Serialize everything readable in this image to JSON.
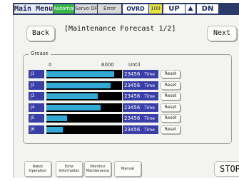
{
  "status_bar": {
    "main_menu": "Main Menu",
    "mode": "Automatic",
    "servo": "Servo OFF",
    "error": "Error",
    "ovrd": "OVRD",
    "override_pct": "100",
    "up_label": "UP",
    "arrow_up": "▲",
    "dn_label": "DN",
    "colors": {
      "bar_bg": "#2b3a6a",
      "mode_green": "#39b54a",
      "ovrd_yellow": "#e8e23a"
    }
  },
  "header": {
    "back_label": "Back",
    "title": "[Maintenance Forecast 1/2]",
    "next_label": "Next"
  },
  "grease": {
    "group_title": "Grease",
    "scale_min": "0",
    "scale_max": "6000",
    "scale_unit": "Until",
    "rows": [
      {
        "axis": "J1",
        "fill": 0.9,
        "remaining": "23456",
        "unit": "Time",
        "reset_label": "Reset"
      },
      {
        "axis": "J2",
        "fill": 0.85,
        "remaining": "23456",
        "unit": "Time",
        "reset_label": "Reset"
      },
      {
        "axis": "J3",
        "fill": 0.68,
        "remaining": "23456",
        "unit": "Time",
        "reset_label": "Reset"
      },
      {
        "axis": "J4",
        "fill": 0.72,
        "remaining": "23456",
        "unit": "Time",
        "reset_label": "Reset"
      },
      {
        "axis": "J5",
        "fill": 0.27,
        "remaining": "23456",
        "unit": "Time",
        "reset_label": "Reset"
      },
      {
        "axis": "J6",
        "fill": 0.22,
        "remaining": "23456",
        "unit": "Time",
        "reset_label": "Reset"
      }
    ],
    "colors": {
      "axis_bg": "#3a3fa8",
      "bar_fill": "#35a9d6",
      "bar_track": "#000000"
    }
  },
  "footer": {
    "robot_operation": [
      "Robot",
      "Operation"
    ],
    "error_information": [
      "Error",
      "Information"
    ],
    "monitor_maintenance": [
      "Monitor/",
      "Maintenance"
    ],
    "manual": [
      "Manual"
    ],
    "stop_label": "STOP"
  }
}
